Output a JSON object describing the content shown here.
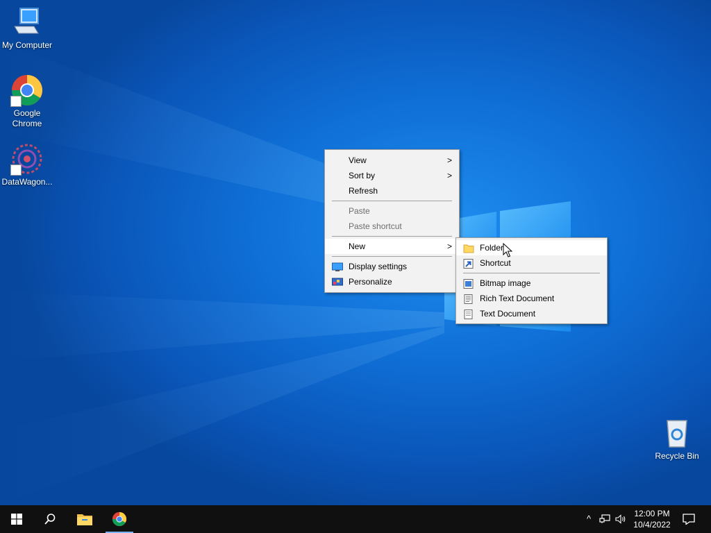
{
  "desktop": {
    "icons": [
      {
        "label": "My Computer",
        "icon": "computer-icon"
      },
      {
        "label": "Google Chrome",
        "icon": "chrome-icon"
      },
      {
        "label": "DataWagon...",
        "icon": "datawagon-icon"
      },
      {
        "label": "Recycle Bin",
        "icon": "recycle-bin-icon"
      }
    ]
  },
  "context_menu": {
    "items": [
      {
        "label": "View",
        "arrow": ">"
      },
      {
        "label": "Sort by",
        "arrow": ">"
      },
      {
        "label": "Refresh"
      },
      {
        "label": "Paste",
        "disabled": true
      },
      {
        "label": "Paste shortcut",
        "disabled": true
      },
      {
        "label": "New",
        "arrow": ">"
      },
      {
        "label": "Display settings",
        "icon": "display-icon"
      },
      {
        "label": "Personalize",
        "icon": "personalize-icon"
      }
    ]
  },
  "submenu_new": {
    "items": [
      {
        "label": "Folder",
        "icon": "folder-icon"
      },
      {
        "label": "Shortcut",
        "icon": "shortcut-icon"
      },
      {
        "label": "Bitmap image",
        "icon": "bitmap-icon"
      },
      {
        "label": "Rich Text Document",
        "icon": "rich-text-icon"
      },
      {
        "label": "Text Document",
        "icon": "text-document-icon"
      }
    ]
  },
  "taskbar": {
    "items": [
      "start-icon",
      "search-icon",
      "file-explorer-icon",
      "chrome-icon"
    ],
    "tray": {
      "chevron": "^",
      "time": "12:00 PM",
      "date": "10/4/2022"
    }
  },
  "colors": {
    "desktop_blue": "#0f6fd6",
    "taskbar": "#101010",
    "menu_bg": "#f2f2f2"
  }
}
